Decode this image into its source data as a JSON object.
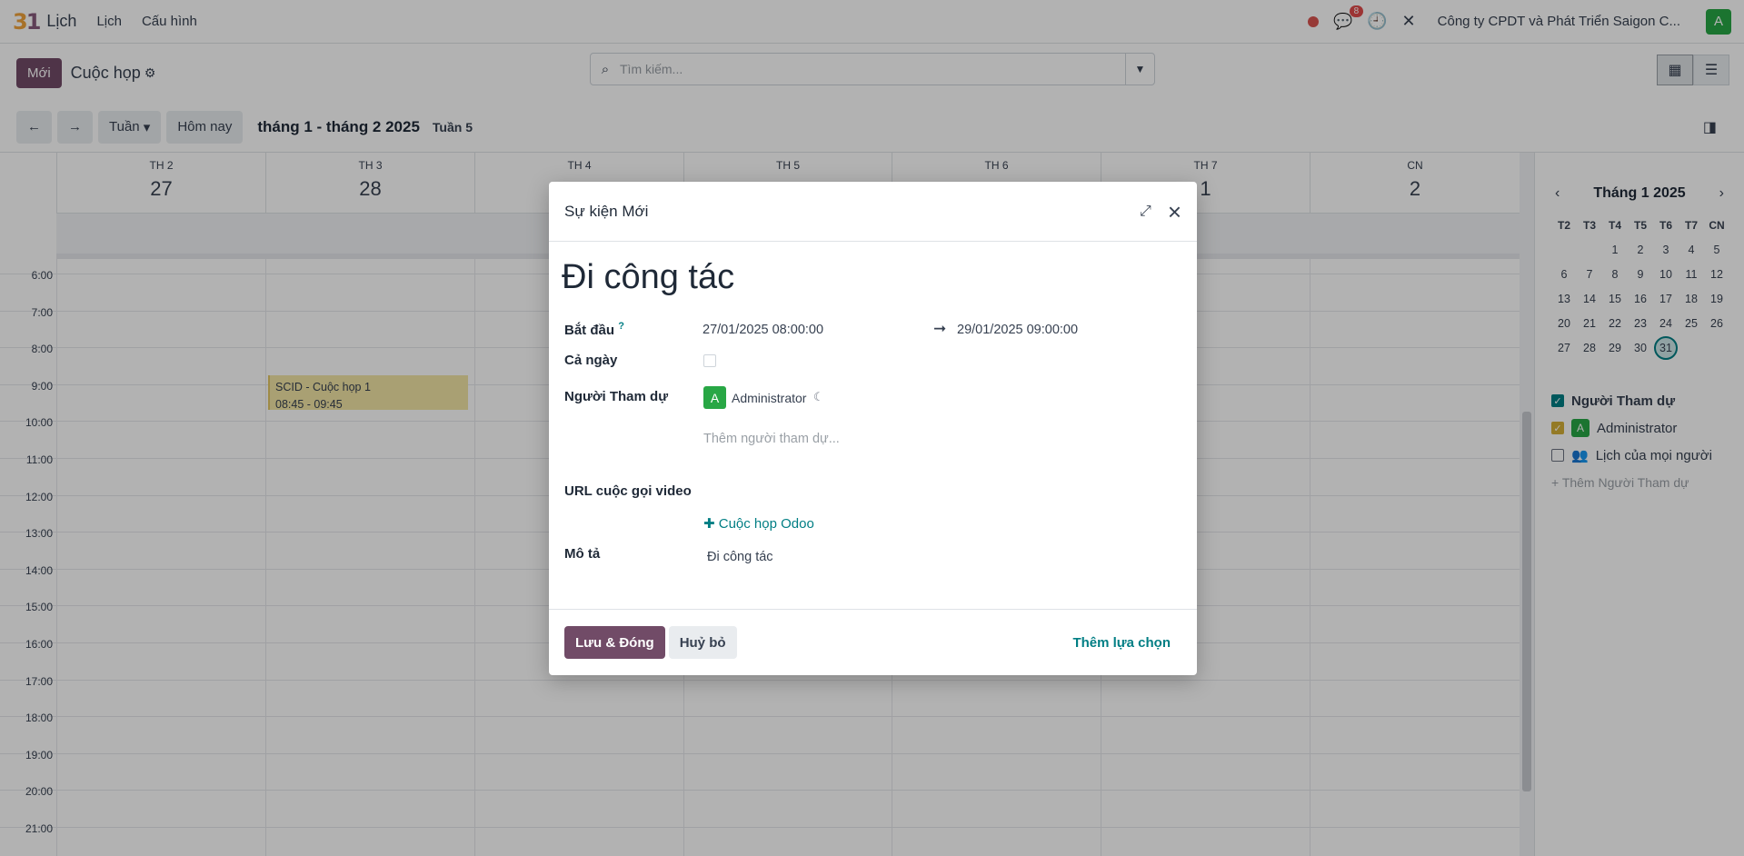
{
  "navbar": {
    "brand_mark": "31",
    "app_name": "Lịch",
    "menu": [
      "Lịch",
      "Cấu hình"
    ],
    "chat_count": "8",
    "company": "Công ty CPDT và Phát Triển Saigon C...",
    "user_initial": "A"
  },
  "control_panel": {
    "new_button": "Mới",
    "title": "Cuộc họp",
    "search_placeholder": "Tìm kiếm..."
  },
  "toolbar": {
    "scale": "Tuần",
    "today": "Hôm nay",
    "range_title": "tháng 1 - tháng 2 2025",
    "week_label": "Tuần 5"
  },
  "week": {
    "days": [
      {
        "name": "TH 2",
        "date": "27"
      },
      {
        "name": "TH 3",
        "date": "28"
      },
      {
        "name": "TH 4",
        "date": ""
      },
      {
        "name": "TH 5",
        "date": ""
      },
      {
        "name": "TH 6",
        "date": ""
      },
      {
        "name": "TH 7",
        "date": "1"
      },
      {
        "name": "CN",
        "date": "2"
      }
    ],
    "hours": [
      "6:00",
      "7:00",
      "8:00",
      "9:00",
      "10:00",
      "11:00",
      "12:00",
      "13:00",
      "14:00",
      "15:00",
      "16:00",
      "17:00",
      "18:00",
      "19:00",
      "20:00",
      "21:00"
    ],
    "event": {
      "title": "SCID - Cuộc họp 1",
      "time": "08:45 - 09:45"
    }
  },
  "sidebar": {
    "mini_title": "Tháng 1 2025",
    "weekday_heads": [
      "T2",
      "T3",
      "T4",
      "T5",
      "T6",
      "T7",
      "CN"
    ],
    "weeks": [
      [
        "",
        "",
        "1",
        "2",
        "3",
        "4",
        "5"
      ],
      [
        "6",
        "7",
        "8",
        "9",
        "10",
        "11",
        "12"
      ],
      [
        "13",
        "14",
        "15",
        "16",
        "17",
        "18",
        "19"
      ],
      [
        "20",
        "21",
        "22",
        "23",
        "24",
        "25",
        "26"
      ],
      [
        "27",
        "28",
        "29",
        "30",
        "31",
        "",
        ""
      ]
    ],
    "today": "31",
    "filter_heading": "Người Tham dự",
    "filter_admin": "Administrator",
    "filter_everyone": "Lịch của mọi người",
    "add_attendee": "+ Thêm Người Tham dự"
  },
  "dialog": {
    "title": "Sự kiện Mới",
    "event_name": "Đi công tác",
    "start_label": "Bắt đầu",
    "start_help": "?",
    "start_value": "27/01/2025 08:00:00",
    "end_value": "29/01/2025 09:00:00",
    "allday_label": "Cả ngày",
    "attendees_label": "Người Tham dự",
    "attendee_initial": "A",
    "attendee_name": "Administrator",
    "attendee_placeholder": "Thêm người tham dự...",
    "video_label": "URL cuộc gọi video",
    "video_link": "✚ Cuộc họp Odoo",
    "desc_label": "Mô tả",
    "desc_value": "Đi công tác",
    "save_button": "Lưu & Đóng",
    "cancel_button": "Huỷ bỏ",
    "more_button": "Thêm lựa chọn"
  },
  "colors": {
    "primary": "#714b67",
    "accent": "#017e84",
    "event_bg": "#f3e6a5",
    "avatar": "#28a745"
  }
}
